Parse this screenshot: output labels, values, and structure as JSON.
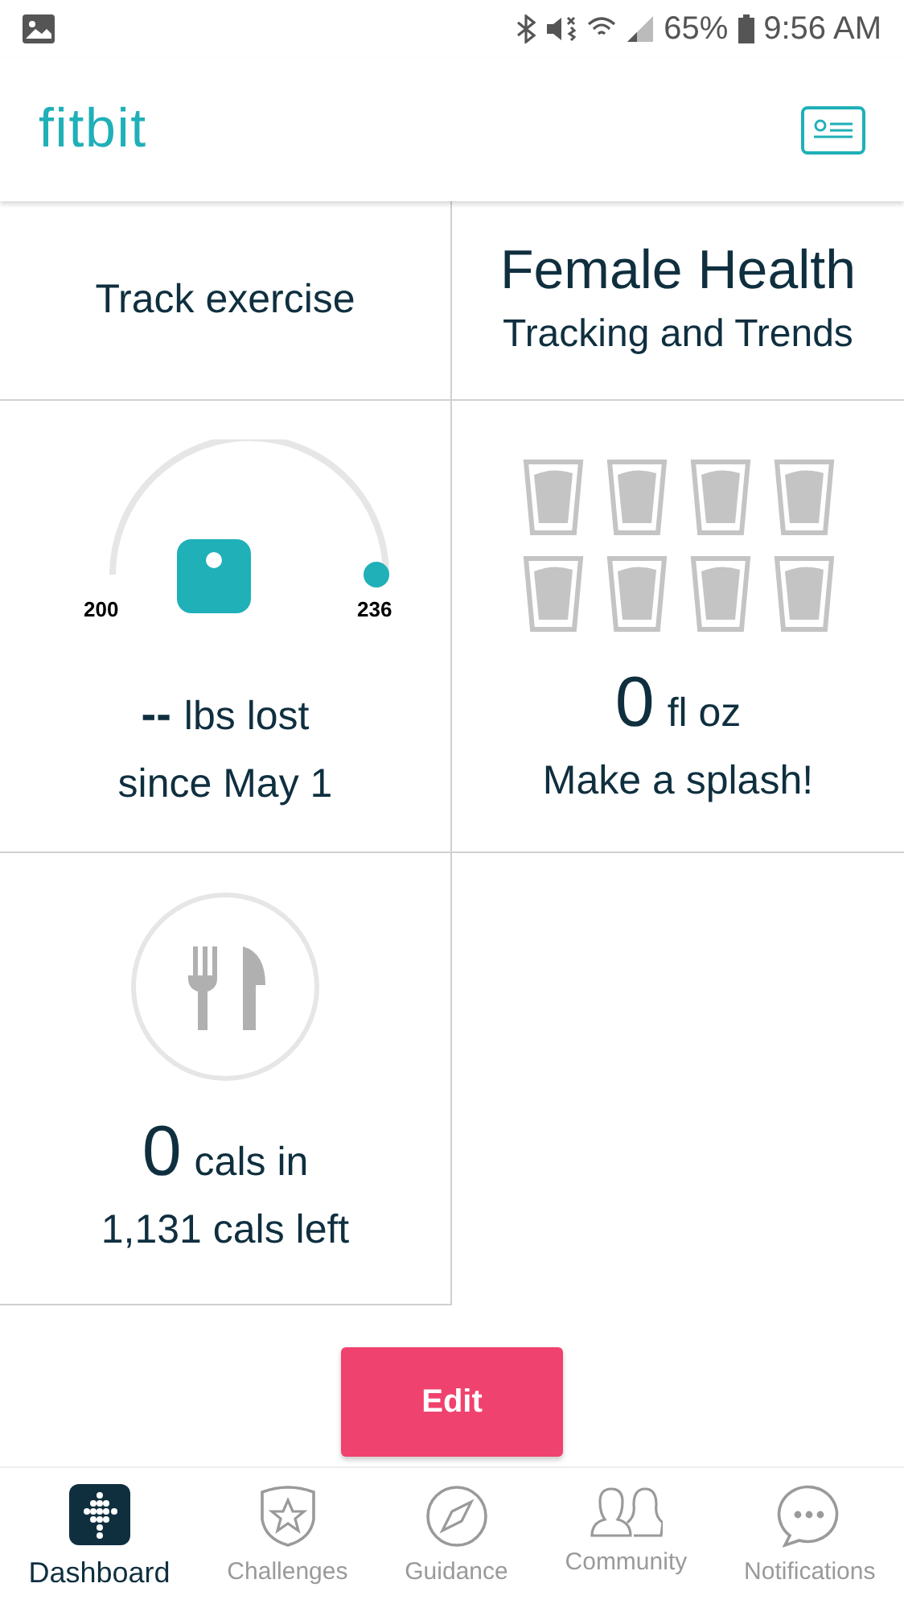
{
  "status_bar": {
    "battery": "65%",
    "time": "9:56 AM"
  },
  "header": {
    "logo": "fitbit"
  },
  "tiles": [
    {
      "kind": "exercise",
      "title": "Track exercise"
    },
    {
      "kind": "female_health",
      "title": "Female Health",
      "subtitle": "Tracking and Trends"
    },
    {
      "kind": "weight",
      "start": "200",
      "goal": "236",
      "value": "--",
      "unit": "lbs lost",
      "subtitle": "since May 1"
    },
    {
      "kind": "water",
      "value": "0",
      "unit": "fl oz",
      "subtitle": "Make a splash!"
    },
    {
      "kind": "food",
      "value": "0",
      "unit": "cals in",
      "subtitle": "1,131 cals left"
    }
  ],
  "edit_button": "Edit",
  "nav": [
    {
      "kind": "dashboard",
      "label": "Dashboard",
      "selected": true
    },
    {
      "kind": "challenges",
      "label": "Challenges",
      "selected": false
    },
    {
      "kind": "guidance",
      "label": "Guidance",
      "selected": false
    },
    {
      "kind": "community",
      "label": "Community",
      "selected": false
    },
    {
      "kind": "notifications",
      "label": "Notifications",
      "selected": false
    }
  ]
}
